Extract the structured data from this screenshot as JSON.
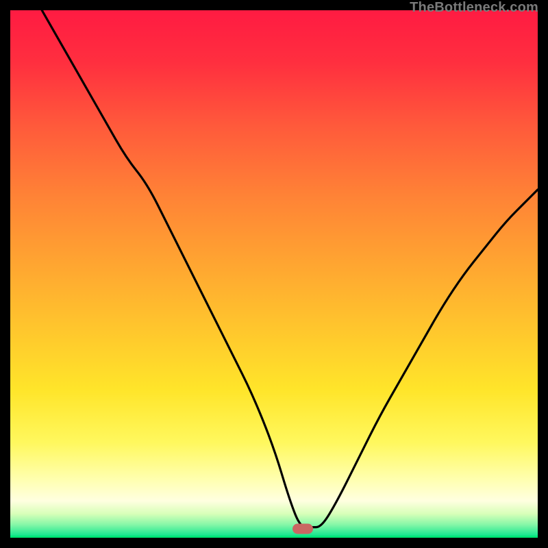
{
  "watermark": "TheBottleneck.com",
  "colors": {
    "black": "#000000",
    "watermark_text": "#7a7a7a",
    "capsule_fill": "#c96762",
    "green_stroke": "#00e676"
  },
  "gradient_stops": [
    {
      "offset": 0.0,
      "color": "#ff1b42"
    },
    {
      "offset": 0.1,
      "color": "#ff2f3f"
    },
    {
      "offset": 0.22,
      "color": "#ff5a3b"
    },
    {
      "offset": 0.35,
      "color": "#ff8236"
    },
    {
      "offset": 0.48,
      "color": "#ffa531"
    },
    {
      "offset": 0.6,
      "color": "#ffc52d"
    },
    {
      "offset": 0.72,
      "color": "#ffe52a"
    },
    {
      "offset": 0.82,
      "color": "#fff85e"
    },
    {
      "offset": 0.89,
      "color": "#ffffb0"
    },
    {
      "offset": 0.93,
      "color": "#ffffe0"
    },
    {
      "offset": 0.955,
      "color": "#d7ffb8"
    },
    {
      "offset": 0.975,
      "color": "#86f7a8"
    },
    {
      "offset": 1.0,
      "color": "#00e38a"
    }
  ],
  "capsule": {
    "x_frac": 0.555,
    "y_frac": 0.983
  },
  "chart_data": {
    "type": "line",
    "title": "",
    "xlabel": "",
    "ylabel": "",
    "xlim": [
      0,
      100
    ],
    "ylim": [
      0,
      100
    ],
    "note": "Axis values are estimated from pixel geometry; the source image has no numeric axis labels.",
    "series": [
      {
        "name": "bottleneck-curve",
        "x": [
          6,
          10,
          14,
          18,
          22,
          26,
          30,
          34,
          38,
          42,
          46,
          50,
          53,
          55,
          57,
          59,
          62,
          66,
          70,
          74,
          78,
          82,
          86,
          90,
          94,
          98,
          100
        ],
        "y": [
          100,
          93,
          86,
          79,
          72,
          67,
          59,
          51,
          43,
          35,
          27,
          17,
          7,
          2,
          2,
          2,
          7,
          15,
          23,
          30,
          37,
          44,
          50,
          55,
          60,
          64,
          66
        ]
      }
    ],
    "marker": {
      "x": 55.5,
      "y": 1.7,
      "shape": "capsule"
    },
    "background": "vertical-gradient red→orange→yellow→pale→green",
    "frame": "black"
  }
}
